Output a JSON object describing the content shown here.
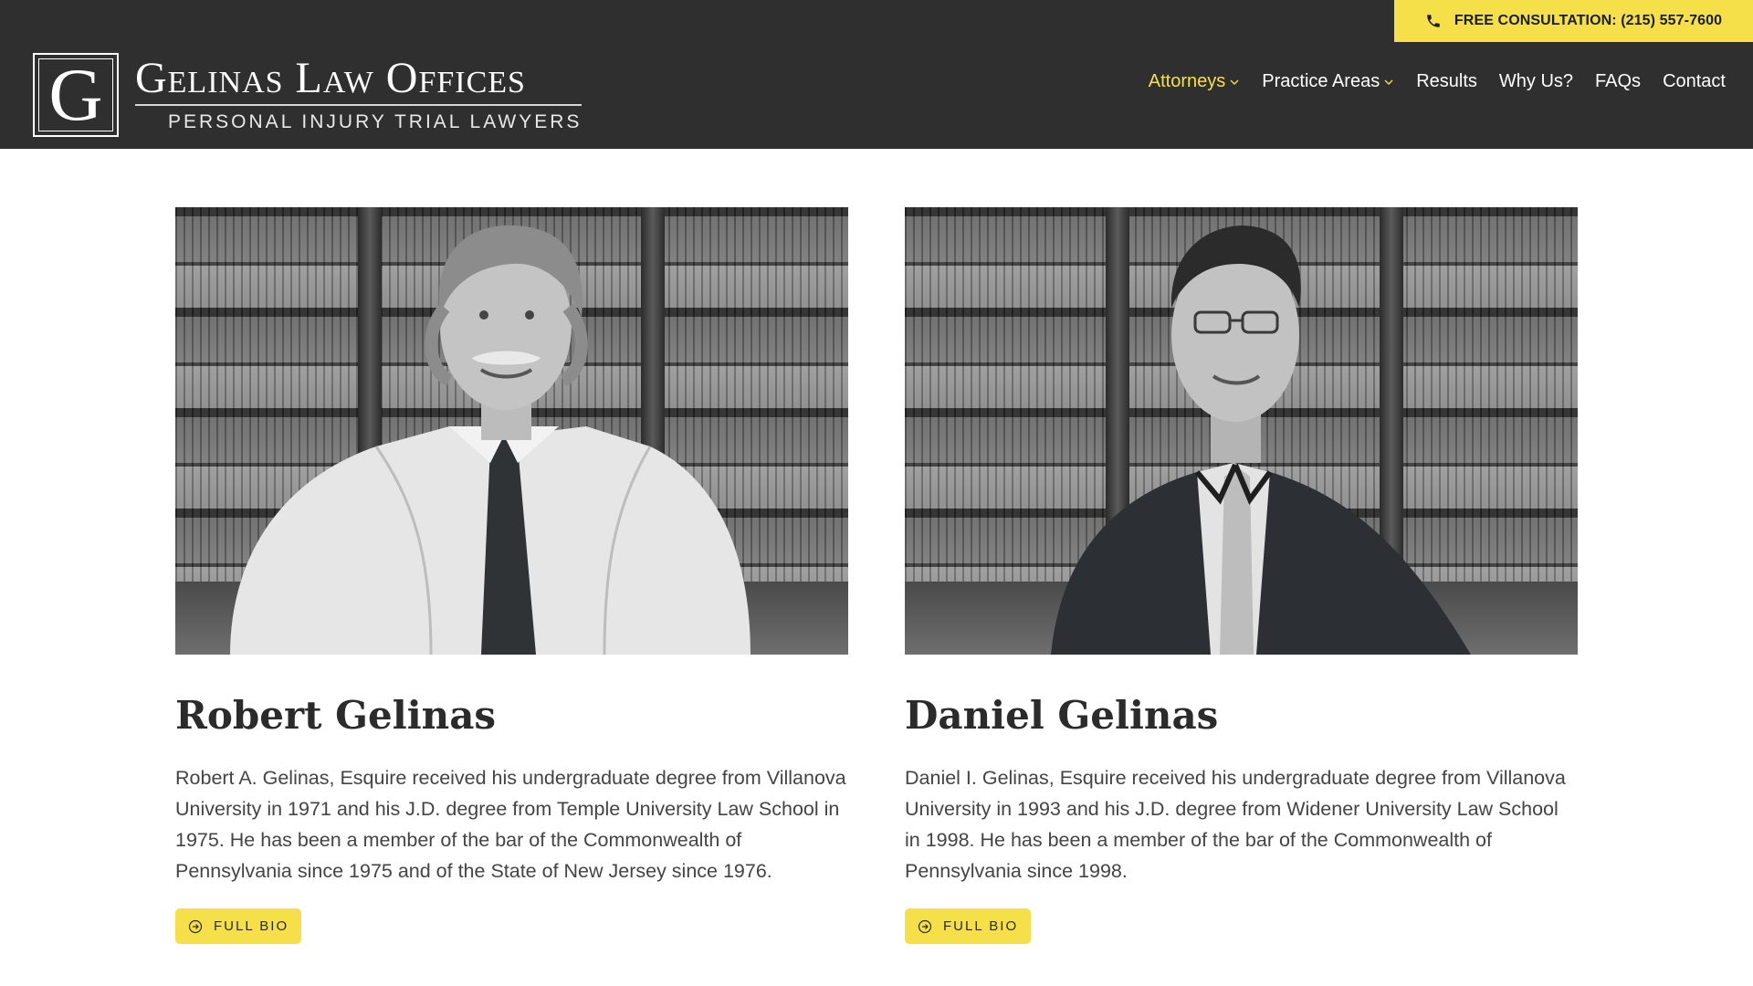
{
  "topbar": {
    "consultation_label": "FREE CONSULTATION: (215) 557-7600",
    "icon": "phone-icon"
  },
  "logo": {
    "monogram": "G",
    "title": "Gelinas Law Offices",
    "subtitle": "PERSONAL INJURY TRIAL LAWYERS"
  },
  "nav": {
    "items": [
      {
        "label": "Attorneys",
        "active": true,
        "dropdown": true
      },
      {
        "label": "Practice Areas",
        "active": false,
        "dropdown": true
      },
      {
        "label": "Results",
        "active": false,
        "dropdown": false
      },
      {
        "label": "Why Us?",
        "active": false,
        "dropdown": false
      },
      {
        "label": "FAQs",
        "active": false,
        "dropdown": false
      },
      {
        "label": "Contact",
        "active": false,
        "dropdown": false
      }
    ]
  },
  "attorneys": [
    {
      "name": "Robert Gelinas",
      "bio": "Robert A. Gelinas, Esquire received his undergraduate degree from Villanova University in 1971 and his J.D. degree from Temple University Law School in 1975. He has been a member of the bar of the Commonwealth of Pennsylvania since 1975 and of the State of New Jersey since 1976.",
      "button_label": "FULL BIO"
    },
    {
      "name": "Daniel Gelinas",
      "bio": "Daniel I. Gelinas, Esquire received his undergraduate degree from Villanova University in 1993 and his J.D. degree from Widener University Law School in 1998. He has been a member of the bar of the Commonwealth of Pennsylvania since 1998.",
      "button_label": "FULL BIO"
    }
  ],
  "colors": {
    "header_bg": "#2f2f2f",
    "accent": "#f5e04a",
    "text": "#444444"
  }
}
